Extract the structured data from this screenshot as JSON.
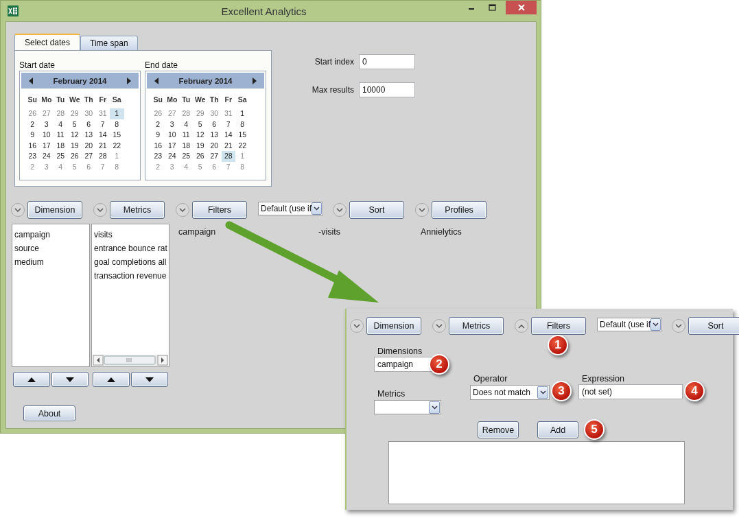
{
  "window": {
    "title": "Excellent Analytics"
  },
  "date_tabs": [
    {
      "label": "Select dates",
      "selected": true
    },
    {
      "label": "Time span",
      "selected": false
    }
  ],
  "calendars": [
    {
      "label": "Start date",
      "month": "February 2014",
      "weekdays": [
        "Su",
        "Mo",
        "Tu",
        "We",
        "Th",
        "Fr",
        "Sa"
      ],
      "weeks": [
        [
          {
            "day": "26",
            "muted": true,
            "selected": false
          },
          {
            "day": "27",
            "muted": true,
            "selected": false
          },
          {
            "day": "28",
            "muted": true,
            "selected": false
          },
          {
            "day": "29",
            "muted": true,
            "selected": false
          },
          {
            "day": "30",
            "muted": true,
            "selected": false
          },
          {
            "day": "31",
            "muted": true,
            "selected": false
          },
          {
            "day": "1",
            "muted": false,
            "selected": true
          }
        ],
        [
          {
            "day": "2",
            "muted": false,
            "selected": false
          },
          {
            "day": "3",
            "muted": false,
            "selected": false
          },
          {
            "day": "4",
            "muted": false,
            "selected": false
          },
          {
            "day": "5",
            "muted": false,
            "selected": false
          },
          {
            "day": "6",
            "muted": false,
            "selected": false
          },
          {
            "day": "7",
            "muted": false,
            "selected": false
          },
          {
            "day": "8",
            "muted": false,
            "selected": false
          }
        ],
        [
          {
            "day": "9",
            "muted": false,
            "selected": false
          },
          {
            "day": "10",
            "muted": false,
            "selected": false
          },
          {
            "day": "11",
            "muted": false,
            "selected": false
          },
          {
            "day": "12",
            "muted": false,
            "selected": false
          },
          {
            "day": "13",
            "muted": false,
            "selected": false
          },
          {
            "day": "14",
            "muted": false,
            "selected": false
          },
          {
            "day": "15",
            "muted": false,
            "selected": false
          }
        ],
        [
          {
            "day": "16",
            "muted": false,
            "selected": false
          },
          {
            "day": "17",
            "muted": false,
            "selected": false
          },
          {
            "day": "18",
            "muted": false,
            "selected": false
          },
          {
            "day": "19",
            "muted": false,
            "selected": false
          },
          {
            "day": "20",
            "muted": false,
            "selected": false
          },
          {
            "day": "21",
            "muted": false,
            "selected": false
          },
          {
            "day": "22",
            "muted": false,
            "selected": false
          }
        ],
        [
          {
            "day": "23",
            "muted": false,
            "selected": false
          },
          {
            "day": "24",
            "muted": false,
            "selected": false
          },
          {
            "day": "25",
            "muted": false,
            "selected": false
          },
          {
            "day": "26",
            "muted": false,
            "selected": false
          },
          {
            "day": "27",
            "muted": false,
            "selected": false
          },
          {
            "day": "28",
            "muted": false,
            "selected": false
          },
          {
            "day": "1",
            "muted": true,
            "selected": false
          }
        ],
        [
          {
            "day": "2",
            "muted": true,
            "selected": false
          },
          {
            "day": "3",
            "muted": true,
            "selected": false
          },
          {
            "day": "4",
            "muted": true,
            "selected": false
          },
          {
            "day": "5",
            "muted": true,
            "selected": false
          },
          {
            "day": "6",
            "muted": true,
            "selected": false
          },
          {
            "day": "7",
            "muted": true,
            "selected": false
          },
          {
            "day": "8",
            "muted": true,
            "selected": false
          }
        ]
      ]
    },
    {
      "label": "End date",
      "month": "February 2014",
      "weekdays": [
        "Su",
        "Mo",
        "Tu",
        "We",
        "Th",
        "Fr",
        "Sa"
      ],
      "weeks": [
        [
          {
            "day": "26",
            "muted": true,
            "selected": false
          },
          {
            "day": "27",
            "muted": true,
            "selected": false
          },
          {
            "day": "28",
            "muted": true,
            "selected": false
          },
          {
            "day": "29",
            "muted": true,
            "selected": false
          },
          {
            "day": "30",
            "muted": true,
            "selected": false
          },
          {
            "day": "31",
            "muted": true,
            "selected": false
          },
          {
            "day": "1",
            "muted": false,
            "selected": false
          }
        ],
        [
          {
            "day": "2",
            "muted": false,
            "selected": false
          },
          {
            "day": "3",
            "muted": false,
            "selected": false
          },
          {
            "day": "4",
            "muted": false,
            "selected": false
          },
          {
            "day": "5",
            "muted": false,
            "selected": false
          },
          {
            "day": "6",
            "muted": false,
            "selected": false
          },
          {
            "day": "7",
            "muted": false,
            "selected": false
          },
          {
            "day": "8",
            "muted": false,
            "selected": false
          }
        ],
        [
          {
            "day": "9",
            "muted": false,
            "selected": false
          },
          {
            "day": "10",
            "muted": false,
            "selected": false
          },
          {
            "day": "11",
            "muted": false,
            "selected": false
          },
          {
            "day": "12",
            "muted": false,
            "selected": false
          },
          {
            "day": "13",
            "muted": false,
            "selected": false
          },
          {
            "day": "14",
            "muted": false,
            "selected": false
          },
          {
            "day": "15",
            "muted": false,
            "selected": false
          }
        ],
        [
          {
            "day": "16",
            "muted": false,
            "selected": false
          },
          {
            "day": "17",
            "muted": false,
            "selected": false
          },
          {
            "day": "18",
            "muted": false,
            "selected": false
          },
          {
            "day": "19",
            "muted": false,
            "selected": false
          },
          {
            "day": "20",
            "muted": false,
            "selected": false
          },
          {
            "day": "21",
            "muted": false,
            "selected": false
          },
          {
            "day": "22",
            "muted": false,
            "selected": false
          }
        ],
        [
          {
            "day": "23",
            "muted": false,
            "selected": false
          },
          {
            "day": "24",
            "muted": false,
            "selected": false
          },
          {
            "day": "25",
            "muted": false,
            "selected": false
          },
          {
            "day": "26",
            "muted": false,
            "selected": false
          },
          {
            "day": "27",
            "muted": false,
            "selected": false
          },
          {
            "day": "28",
            "muted": false,
            "selected": true
          },
          {
            "day": "1",
            "muted": true,
            "selected": false
          }
        ],
        [
          {
            "day": "2",
            "muted": true,
            "selected": false
          },
          {
            "day": "3",
            "muted": true,
            "selected": false
          },
          {
            "day": "4",
            "muted": true,
            "selected": false
          },
          {
            "day": "5",
            "muted": true,
            "selected": false
          },
          {
            "day": "6",
            "muted": true,
            "selected": false
          },
          {
            "day": "7",
            "muted": true,
            "selected": false
          },
          {
            "day": "8",
            "muted": true,
            "selected": false
          }
        ]
      ]
    }
  ],
  "start_index": {
    "label": "Start index",
    "value": "0"
  },
  "max_results": {
    "label": "Max results",
    "value": "10000"
  },
  "toolbar": [
    {
      "kind": "section",
      "label": "Dimension",
      "expanded": false
    },
    {
      "kind": "section",
      "label": "Metrics",
      "expanded": false
    },
    {
      "kind": "section",
      "label": "Filters",
      "expanded": false
    },
    {
      "kind": "dropdown",
      "value": "Default (use if"
    },
    {
      "kind": "section",
      "label": "Sort",
      "expanded": false
    },
    {
      "kind": "section",
      "label": "Profiles",
      "expanded": false
    }
  ],
  "dimension_list": [
    "campaign",
    "source",
    "medium"
  ],
  "metrics_list": [
    "visits",
    "entrance bounce rat",
    "goal completions all",
    "transaction revenue"
  ],
  "filter_summary": "campaign",
  "sort_summary": "-visits",
  "profile_summary": "Annielytics",
  "about_button": "About",
  "detail_panel": {
    "toolbar": [
      {
        "kind": "section",
        "label": "Dimension",
        "expanded": false
      },
      {
        "kind": "section",
        "label": "Metrics",
        "expanded": false
      },
      {
        "kind": "section",
        "label": "Filters",
        "expanded": true,
        "callout": "1"
      },
      {
        "kind": "dropdown",
        "value": "Default (use if"
      },
      {
        "kind": "section",
        "label": "Sort",
        "expanded": false
      }
    ],
    "dimensions": {
      "label": "Dimensions",
      "value": "campaign",
      "callout": "2"
    },
    "metrics": {
      "label": "Metrics"
    },
    "operator": {
      "label": "Operator",
      "value": "Does not match",
      "callout": "3"
    },
    "expression": {
      "label": "Expression",
      "value": "(not set)",
      "callout": "4"
    },
    "buttons": [
      {
        "label": "Remove"
      },
      {
        "label": "Add",
        "callout": "5"
      }
    ]
  }
}
